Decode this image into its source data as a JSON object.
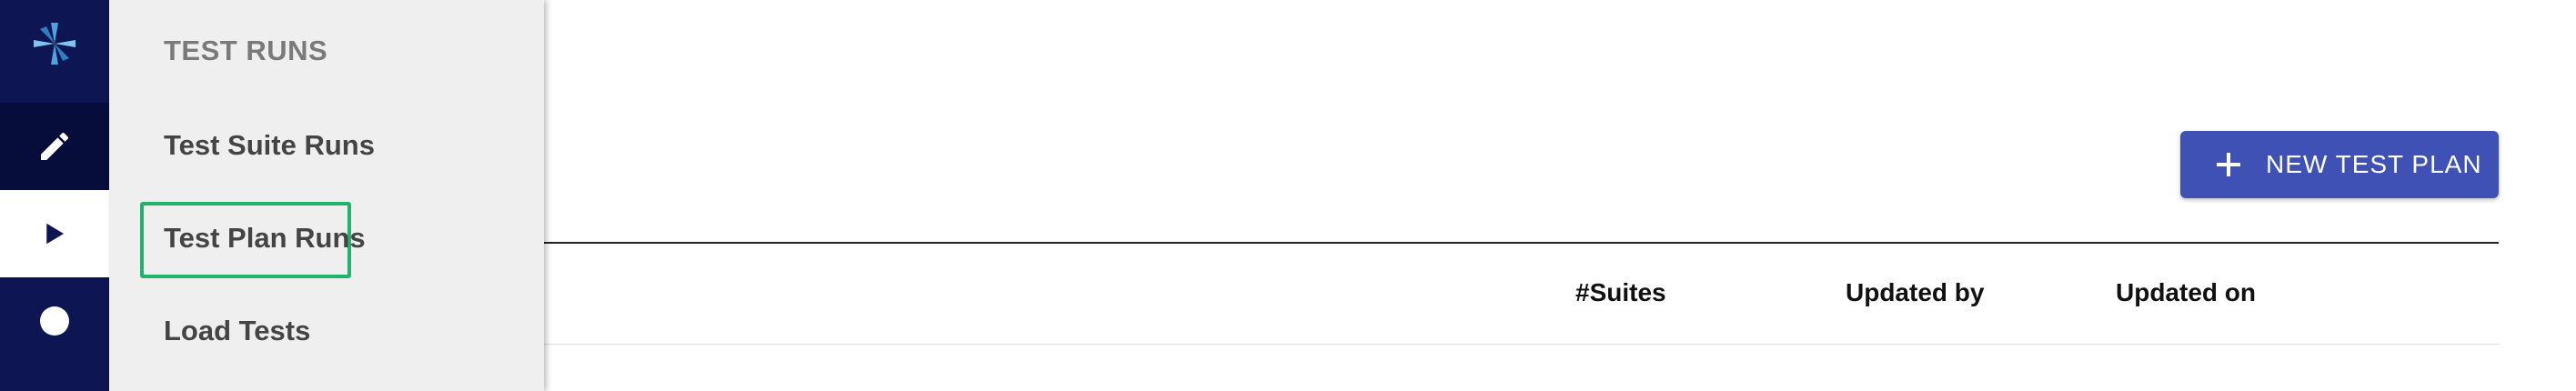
{
  "icons": {
    "logo": "pinwheel-logo-icon",
    "edit": "pencil-icon",
    "play": "play-icon",
    "record": "circle-icon",
    "add": "plus-icon"
  },
  "colors": {
    "rail": "#0d1652",
    "accent": "#3f51b5",
    "highlight": "#1fb36b"
  },
  "flyout": {
    "heading": "TEST RUNS",
    "items": [
      {
        "label": "Test Suite Runs"
      },
      {
        "label": "Test Plan Runs",
        "highlighted": true
      },
      {
        "label": "Load Tests"
      }
    ]
  },
  "toolbar": {
    "new_test_plan_label": "NEW TEST PLAN"
  },
  "table": {
    "columns": [
      "#Suites",
      "Updated by",
      "Updated on"
    ]
  }
}
